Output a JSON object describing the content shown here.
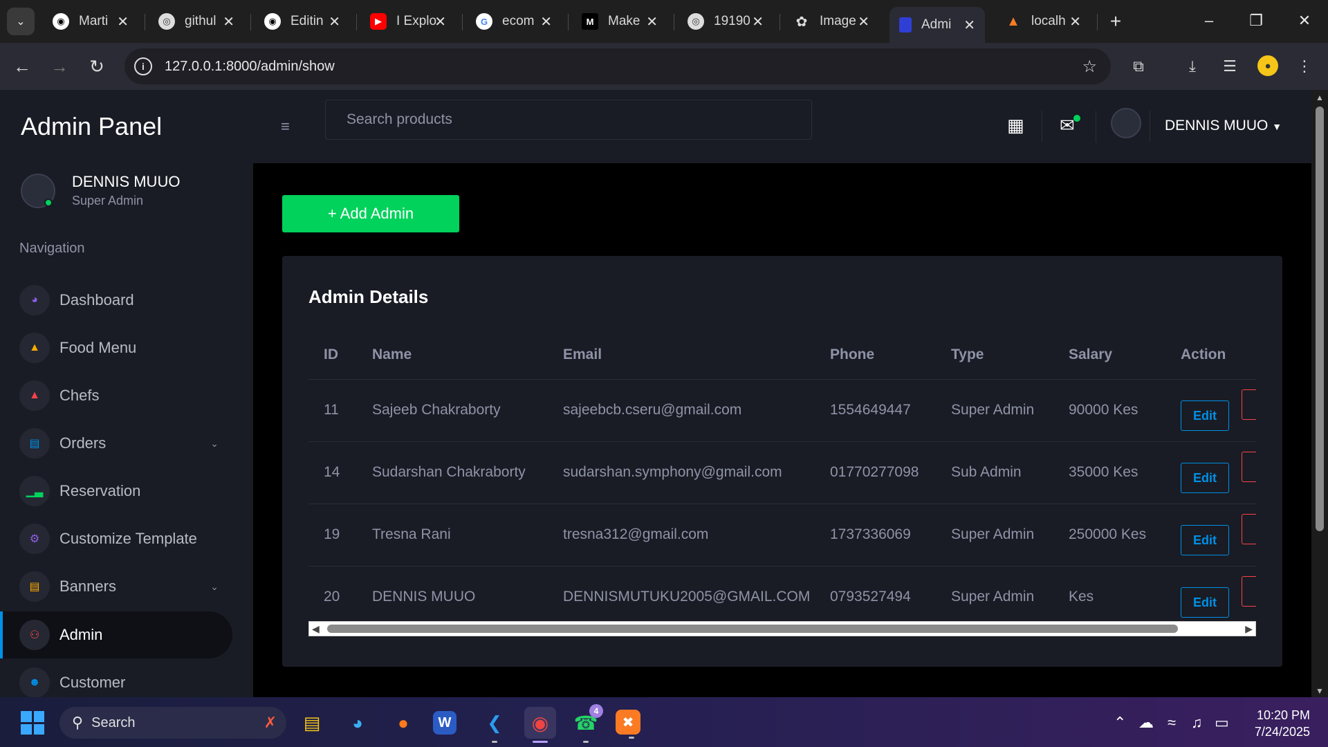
{
  "browser": {
    "tabs": [
      {
        "label": "Marti",
        "icon": "github-icon"
      },
      {
        "label": "githul",
        "icon": "globe-icon"
      },
      {
        "label": "Editin",
        "icon": "github-icon"
      },
      {
        "label": "I Explo",
        "icon": "youtube-icon"
      },
      {
        "label": "ecom",
        "icon": "google-icon"
      },
      {
        "label": "Make",
        "icon": "medium-icon"
      },
      {
        "label": "19190",
        "icon": "globe-icon"
      },
      {
        "label": "Image",
        "icon": "openai-icon"
      },
      {
        "label": "Admi",
        "icon": "page-icon",
        "active": true
      },
      {
        "label": "localh",
        "icon": "xampp-icon"
      }
    ],
    "url": "127.0.0.1:8000/admin/show"
  },
  "sidebar": {
    "brand": "Admin Panel",
    "profile": {
      "name": "DENNIS MUUO",
      "role": "Super Admin"
    },
    "nav_heading": "Navigation",
    "items": [
      {
        "label": "Dashboard",
        "icon": "speedometer-icon",
        "color": "#8f5fe8"
      },
      {
        "label": "Food Menu",
        "icon": "food-icon",
        "color": "#ffab00"
      },
      {
        "label": "Chefs",
        "icon": "chef-icon",
        "color": "#fc424a"
      },
      {
        "label": "Orders",
        "icon": "orders-icon",
        "color": "#0090e7",
        "expandable": true
      },
      {
        "label": "Reservation",
        "icon": "chart-icon",
        "color": "#00d25b"
      },
      {
        "label": "Customize Template",
        "icon": "gear-icon",
        "color": "#8f5fe8"
      },
      {
        "label": "Banners",
        "icon": "banner-icon",
        "color": "#ffab00",
        "expandable": true
      },
      {
        "label": "Admin",
        "icon": "users-icon",
        "color": "#fc424a",
        "active": true
      },
      {
        "label": "Customer",
        "icon": "user-add-icon",
        "color": "#0090e7"
      }
    ]
  },
  "topbar": {
    "search_placeholder": "Search products",
    "user_name": "DENNIS MUUO"
  },
  "main": {
    "add_button": "+ Add Admin",
    "card_title": "Admin Details",
    "columns": [
      "ID",
      "Name",
      "Email",
      "Phone",
      "Type",
      "Salary",
      "Action"
    ],
    "rows": [
      {
        "id": "11",
        "name": "Sajeeb Chakraborty",
        "email": "sajeebcb.cseru@gmail.com",
        "phone": "1554649447",
        "type": "Super Admin",
        "salary": "90000 Kes",
        "edit": "Edit"
      },
      {
        "id": "14",
        "name": "Sudarshan Chakraborty",
        "email": "sudarshan.symphony@gmail.com",
        "phone": "01770277098",
        "type": "Sub Admin",
        "salary": "35000 Kes",
        "edit": "Edit"
      },
      {
        "id": "19",
        "name": "Tresna Rani",
        "email": "tresna312@gmail.com",
        "phone": "1737336069",
        "type": "Super Admin",
        "salary": "250000 Kes",
        "edit": "Edit"
      },
      {
        "id": "20",
        "name": "DENNIS MUUO",
        "email": "DENNISMUTUKU2005@GMAIL.COM",
        "phone": "0793527494",
        "type": "Super Admin",
        "salary": "Kes",
        "edit": "Edit"
      }
    ]
  },
  "taskbar": {
    "search_label": "Search",
    "whatsapp_badge": "4",
    "time": "10:20 PM",
    "date": "7/24/2025"
  },
  "colors": {
    "accent_green": "#00d25b",
    "accent_blue": "#0090e7",
    "danger_red": "#fc424a",
    "sidebar_bg": "#191c24"
  }
}
